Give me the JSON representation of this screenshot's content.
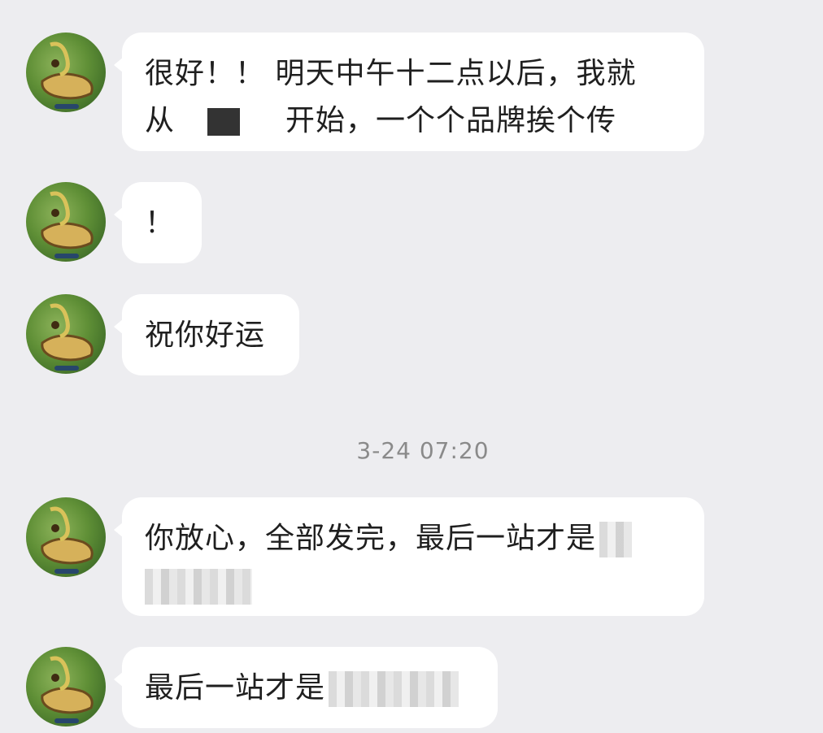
{
  "chat": {
    "timestamp": "3-24 07:20",
    "messages": [
      {
        "line1": "很好！！ 明天中午十二点以后，我就",
        "line2_prefix": "从",
        "line2_suffix": "开始，一个个品牌挨个传"
      },
      {
        "line1": "！"
      },
      {
        "line1": "祝你好运"
      },
      {
        "line1": "你放心，全部发完，最后一站才是"
      },
      {
        "line1": "最后一站才是"
      }
    ]
  },
  "avatar": {
    "icon": "avatar-icon"
  }
}
